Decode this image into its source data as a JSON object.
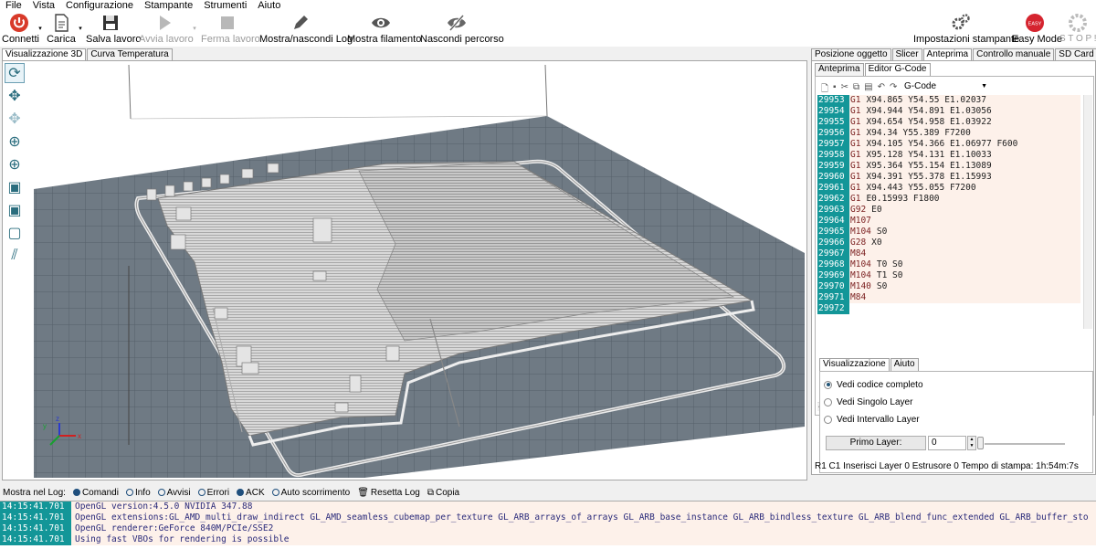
{
  "menu": [
    "File",
    "Vista",
    "Configurazione",
    "Stampante",
    "Strumenti",
    "Aiuto"
  ],
  "toolbar": {
    "connect": "Connetti",
    "load": "Carica",
    "save": "Salva lavoro",
    "start": "Avvia lavoro",
    "stop": "Ferma lavoro",
    "toggle_log": "Mostra/nascondi Log",
    "show_filament": "Mostra filamento",
    "hide_path": "Nascondi percorso",
    "printer_settings": "Impostazioni stampante",
    "easy_mode": "Easy Mode",
    "easy_badge": "EASY",
    "stop_all": "S T O P !"
  },
  "viewport_tabs": [
    "Visualizzazione 3D",
    "Curva Temperatura"
  ],
  "right_tabs": [
    "Posizione oggetto",
    "Slicer",
    "Anteprima",
    "Controllo manuale",
    "SD Card"
  ],
  "preview_tabs": [
    "Anteprima",
    "Editor G-Code"
  ],
  "gcode_select": "G-Code",
  "gcode_lines": [
    {
      "n": "29953",
      "cmd": "G1",
      "args": "X94.865 Y54.55 E1.02037"
    },
    {
      "n": "29954",
      "cmd": "G1",
      "args": "X94.944 Y54.891 E1.03056"
    },
    {
      "n": "29955",
      "cmd": "G1",
      "args": "X94.654 Y54.958 E1.03922"
    },
    {
      "n": "29956",
      "cmd": "G1",
      "args": "X94.34 Y55.389 F7200"
    },
    {
      "n": "29957",
      "cmd": "G1",
      "args": "X94.105 Y54.366 E1.06977 F600"
    },
    {
      "n": "29958",
      "cmd": "G1",
      "args": "X95.128 Y54.131 E1.10033"
    },
    {
      "n": "29959",
      "cmd": "G1",
      "args": "X95.364 Y55.154 E1.13089"
    },
    {
      "n": "29960",
      "cmd": "G1",
      "args": "X94.391 Y55.378 E1.15993"
    },
    {
      "n": "29961",
      "cmd": "G1",
      "args": "X94.443 Y55.055 F7200"
    },
    {
      "n": "29962",
      "cmd": "G1",
      "args": "E0.15993 F1800"
    },
    {
      "n": "29963",
      "cmd": "G92",
      "args": "E0"
    },
    {
      "n": "29964",
      "cmd": "M107",
      "args": ""
    },
    {
      "n": "29965",
      "cmd": "M104",
      "args": "S0"
    },
    {
      "n": "29966",
      "cmd": "G28",
      "args": "X0"
    },
    {
      "n": "29967",
      "cmd": "M84",
      "args": ""
    },
    {
      "n": "29968",
      "cmd": "M104",
      "args": "T0 S0"
    },
    {
      "n": "29969",
      "cmd": "M104",
      "args": "T1 S0"
    },
    {
      "n": "29970",
      "cmd": "M140",
      "args": "S0"
    },
    {
      "n": "29971",
      "cmd": "M84",
      "args": ""
    },
    {
      "n": "29972",
      "cmd": "",
      "args": ""
    }
  ],
  "vis_tabs": [
    "Visualizzazione",
    "Aiuto"
  ],
  "vis_options": [
    "Vedi codice completo",
    "Vedi Singolo Layer",
    "Vedi Intervallo Layer"
  ],
  "vis_selected": 0,
  "first_layer_label": "Primo Layer:",
  "first_layer_value": "0",
  "status": "R1  C1  Inserisci  Layer 0  Estrusore 0  Tempo di stampa: 1h:54m:7s",
  "log_bar": {
    "label": "Mostra nel Log:",
    "options": [
      "Comandi",
      "Info",
      "Avvisi",
      "Errori",
      "ACK",
      "Auto scorrimento"
    ],
    "checked": [
      true,
      false,
      false,
      false,
      true,
      false
    ],
    "reset": "Resetta Log",
    "copy": "Copia"
  },
  "log_lines": [
    {
      "t": "14:15:41.701",
      "m": "OpenGL version:4.5.0 NVIDIA 347.88"
    },
    {
      "t": "14:15:41.701",
      "m": "OpenGL extensions:GL_AMD_multi_draw_indirect GL_AMD_seamless_cubemap_per_texture GL_ARB_arrays_of_arrays GL_ARB_base_instance GL_ARB_bindless_texture GL_ARB_blend_func_extended GL_ARB_buffer_sto"
    },
    {
      "t": "14:15:41.701",
      "m": "OpenGL renderer:GeForce 840M/PCIe/SSE2"
    },
    {
      "t": "14:15:41.701",
      "m": "Using fast VBOs for rendering is possible"
    }
  ],
  "colors": {
    "accent": "#139698",
    "code_bg": "#fdf1ea",
    "plate": "#6b7680"
  }
}
